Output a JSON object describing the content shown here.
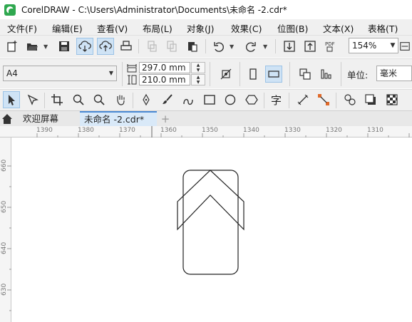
{
  "window": {
    "title": "CorelDRAW - C:\\Users\\Administrator\\Documents\\未命名 -2.cdr*"
  },
  "menu": {
    "items": [
      "文件(F)",
      "编辑(E)",
      "查看(V)",
      "布局(L)",
      "对象(J)",
      "效果(C)",
      "位图(B)",
      "文本(X)",
      "表格(T)"
    ]
  },
  "toolbar": {
    "zoom_level": "154%"
  },
  "property_bar": {
    "page_size": "A4",
    "width": "297.0 mm",
    "height": "210.0 mm",
    "unit_label": "单位:",
    "unit_value": "毫米"
  },
  "tabs": {
    "welcome": "欢迎屏幕",
    "document": "未命名 -2.cdr*",
    "add": "+"
  },
  "ruler": {
    "horizontal": [
      "1390",
      "1380",
      "1370",
      "1360",
      "1350",
      "1340",
      "1330",
      "1320",
      "1310"
    ],
    "vertical": [
      "660",
      "650",
      "640",
      "630"
    ]
  },
  "colors": {
    "app_green": "#2fa84f",
    "active_tab": "#d9e9f8",
    "toolbar_bg": "#f0f0f0"
  }
}
